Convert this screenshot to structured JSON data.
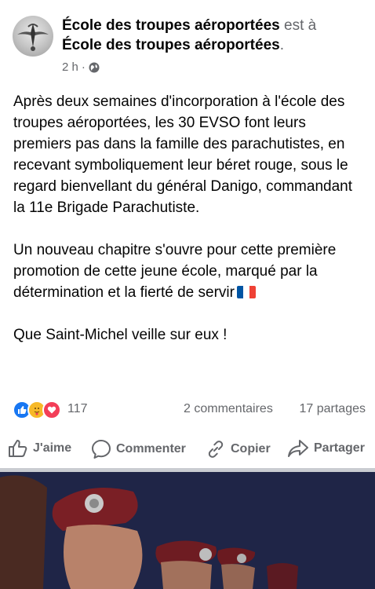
{
  "post": {
    "page_name": "École des troupes aéroportées",
    "connector": "est à",
    "location_name": "École des troupes aéroportées",
    "period": ".",
    "time": "2 h",
    "time_separator": "·",
    "privacy_icon": "globe-icon",
    "paragraph1": "Après deux semaines d'incorporation à l'école des troupes aéroportées, les 30 EVSO font leurs premiers pas dans la famille des parachutistes, en recevant symboliquement leur béret rouge, sous le regard bienvellant du général Danigo, commandant la 11e Brigade Parachutiste.",
    "paragraph2": "Un nouveau chapitre s'ouvre pour cette première promotion de cette jeune école, marqué par la détermination et la fierté de servir",
    "paragraph3": "Que Saint-Michel veille sur eux !",
    "flag_colors": [
      "#0055A4",
      "#FFFFFF",
      "#EF4135"
    ]
  },
  "stats": {
    "reaction_icons": [
      "like-icon",
      "care-icon",
      "love-icon"
    ],
    "reaction_count": "117",
    "comments": "2 commentaires",
    "shares": "17 partages"
  },
  "actions": {
    "like": "J'aime",
    "comment": "Commenter",
    "copy": "Copier",
    "share": "Partager"
  },
  "colors": {
    "text": "#050505",
    "secondary": "#65676b",
    "like_blue": "#1877f2",
    "love_red": "#f33e58",
    "care_yellow": "#f7b928"
  }
}
